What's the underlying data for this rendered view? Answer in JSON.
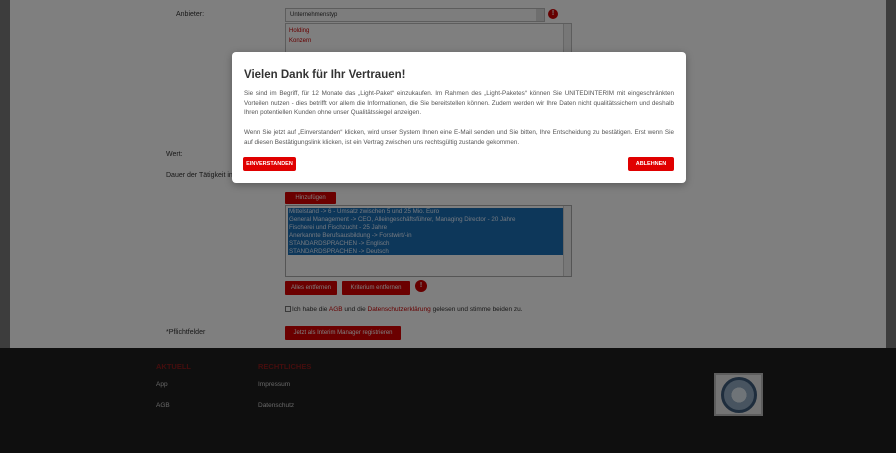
{
  "form": {
    "label_anbieter": "Anbieter:",
    "select_value": "Unternehmenstyp",
    "list_options": [
      "Holding",
      "Konzern"
    ],
    "label_wert": "Wert:",
    "label_dauer": "Dauer der Tätigkeit in",
    "add_button": "Hinzufügen",
    "selected_items": [
      "Mittelstand -> 6 - Umsatz zwischen 5 und 25 Mio. Euro",
      "General Management -> CEO, Alleingeschäftsführer, Managing Director - 20 Jahre",
      "Fischerei und Fischzucht - 25 Jahre",
      "Anerkannte Berufsausbildung -> Forstwirt/-in",
      "STANDARDSPRACHEN -> Englisch",
      "STANDARDSPRACHEN -> Deutsch"
    ],
    "remove_all_button": "Alles entfernen",
    "remove_criterion_button": "Kriterium entfernen",
    "agb_pre": "Ich habe die ",
    "agb_link": "AGB",
    "agb_mid": " und die ",
    "privacy_link": "Datenschutzerklärung",
    "agb_post": " gelesen und stimme beiden zu.",
    "required_label": "*Pflichtfelder",
    "register_button": "Jetzt als Interim Manager registrieren"
  },
  "footer": {
    "col1_heading": "AKTUELL",
    "col1_links": [
      "App",
      "AGB"
    ],
    "col2_heading": "RECHTLICHES",
    "col2_links": [
      "Impressum",
      "Datenschutz"
    ]
  },
  "modal": {
    "title": "Vielen Dank für Ihr Vertrauen!",
    "paragraph1": "Sie sind im Begriff, für 12 Monate das „Light-Paket“ einzukaufen. Im Rahmen des „Light-Paketes“ können Sie UNITEDINTERIM mit eingeschränkten Vorteilen nutzen - dies betrifft vor allem die Informationen, die Sie bereitstellen können. Zudem werden wir Ihre Daten nicht qualitätssichern und deshalb Ihren potentiellen Kunden ohne unser Qualitätssiegel anzeigen.",
    "paragraph2": "Wenn Sie jetzt auf „Einverstanden“ klicken, wird unser System Ihnen eine E-Mail senden und Sie bitten, Ihre Entscheidung zu bestätigen. Erst wenn Sie auf diesen Bestätigungslink klicken, ist ein Vertrag zwischen uns rechtsgültig zustande gekommen.",
    "accept_button": "EINVERSTANDEN",
    "decline_button": "ABLEHNEN"
  },
  "colors": {
    "accent_red": "#e00000",
    "selection_blue": "#1b6fb5",
    "footer_bg": "#1f1f1f",
    "footer_heading": "#8a1b1b"
  },
  "icons": [
    "help-icon",
    "seal-icon"
  ]
}
